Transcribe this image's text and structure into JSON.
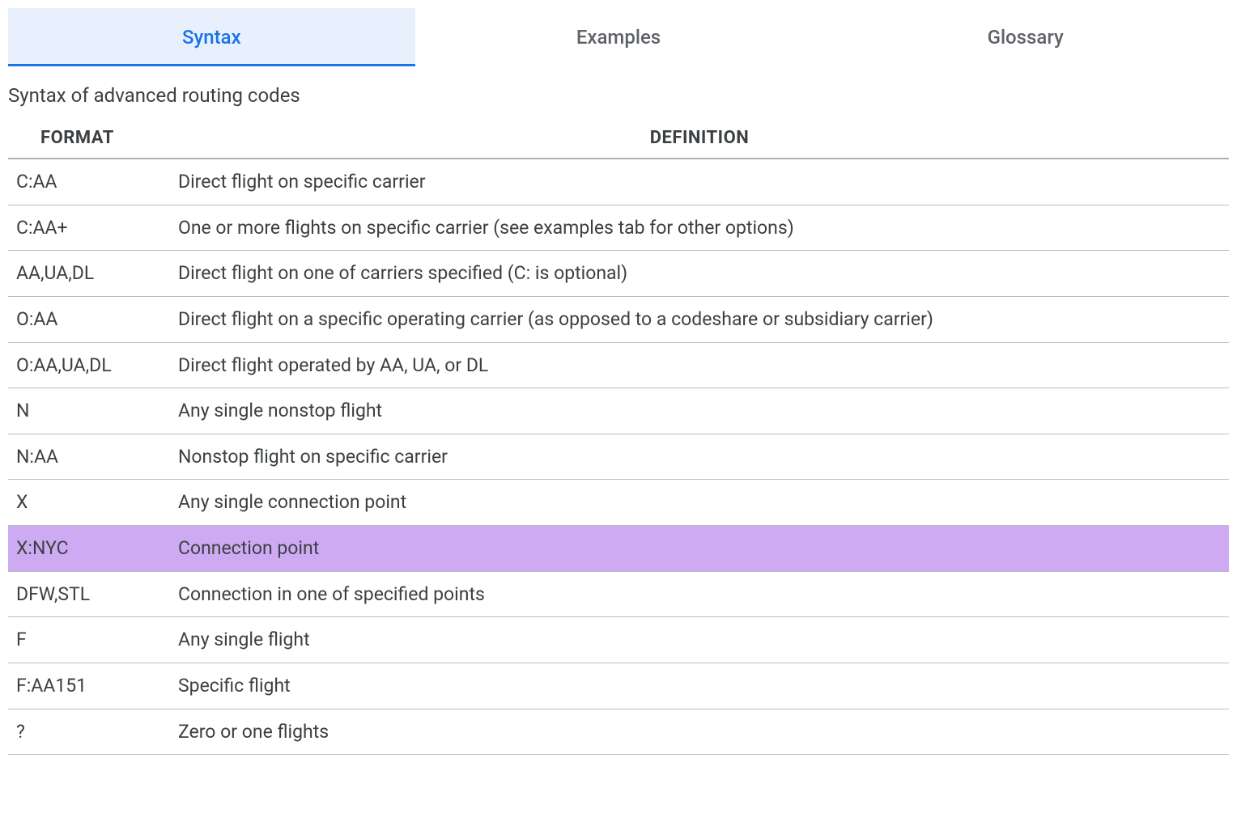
{
  "tabs": [
    {
      "label": "Syntax",
      "active": true
    },
    {
      "label": "Examples",
      "active": false
    },
    {
      "label": "Glossary",
      "active": false
    }
  ],
  "subtitle": "Syntax of advanced routing codes",
  "table": {
    "headers": {
      "format": "FORMAT",
      "definition": "DEFINITION"
    },
    "rows": [
      {
        "format": "C:AA",
        "definition": "Direct flight on specific carrier",
        "highlighted": false
      },
      {
        "format": "C:AA+",
        "definition": "One or more flights on specific carrier (see examples tab for other options)",
        "highlighted": false
      },
      {
        "format": "AA,UA,DL",
        "definition": "Direct flight on one of carriers specified (C: is optional)",
        "highlighted": false
      },
      {
        "format": "O:AA",
        "definition": "Direct flight on a specific operating carrier (as opposed to a codeshare or subsidiary carrier)",
        "highlighted": false
      },
      {
        "format": "O:AA,UA,DL",
        "definition": "Direct flight operated by AA, UA, or DL",
        "highlighted": false
      },
      {
        "format": "N",
        "definition": "Any single nonstop flight",
        "highlighted": false
      },
      {
        "format": "N:AA",
        "definition": "Nonstop flight on specific carrier",
        "highlighted": false
      },
      {
        "format": "X",
        "definition": "Any single connection point",
        "highlighted": false
      },
      {
        "format": "X:NYC",
        "definition": "Connection point",
        "highlighted": true
      },
      {
        "format": "DFW,STL",
        "definition": "Connection in one of specified points",
        "highlighted": false
      },
      {
        "format": "F",
        "definition": "Any single flight",
        "highlighted": false
      },
      {
        "format": "F:AA151",
        "definition": "Specific flight",
        "highlighted": false
      },
      {
        "format": "?",
        "definition": "Zero or one flights",
        "highlighted": false
      }
    ]
  }
}
